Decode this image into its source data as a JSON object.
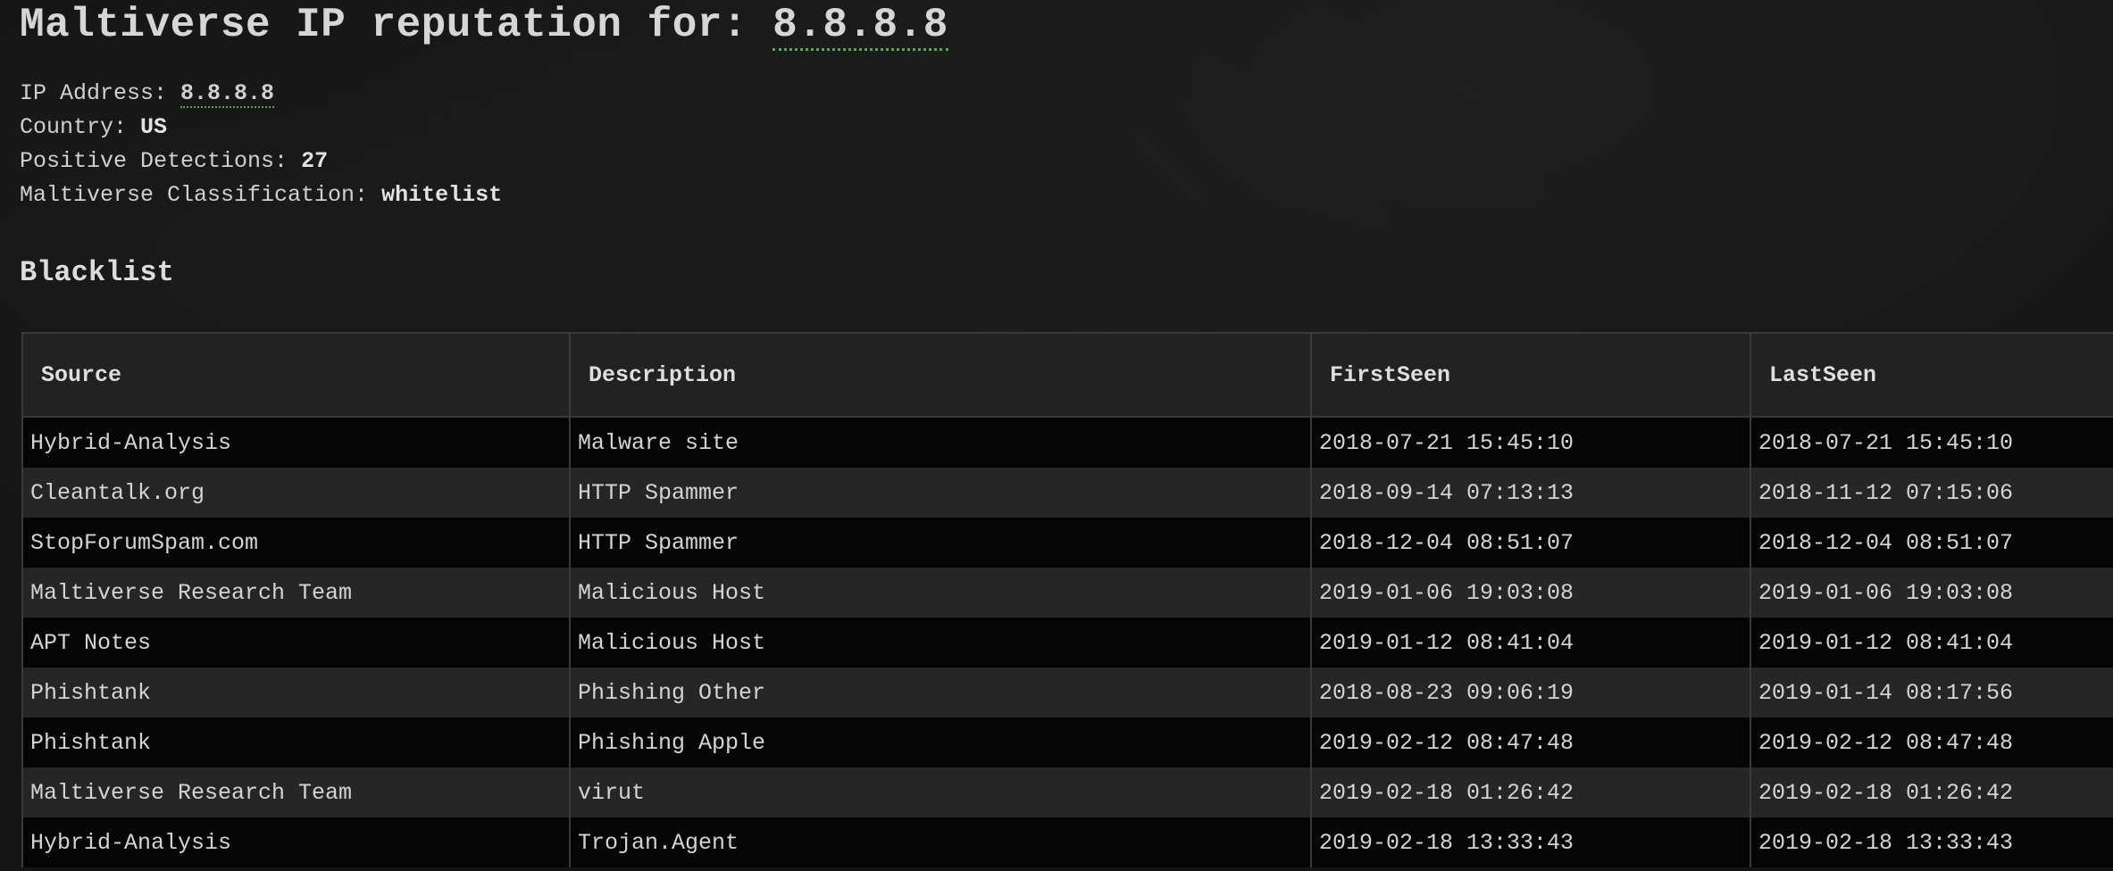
{
  "header": {
    "title_prefix": "Maltiverse IP reputation for: ",
    "title_ip": "8.8.8.8"
  },
  "info": {
    "ip_label": "IP Address: ",
    "ip_value": "8.8.8.8",
    "country_label": "Country: ",
    "country_value": "US",
    "detections_label": "Positive Detections: ",
    "detections_value": "27",
    "classification_label": "Maltiverse Classification: ",
    "classification_value": "whitelist"
  },
  "blacklist": {
    "heading": "Blacklist",
    "columns": [
      "Source",
      "Description",
      "FirstSeen",
      "LastSeen"
    ],
    "rows": [
      [
        "Hybrid-Analysis",
        "Malware site",
        "2018-07-21 15:45:10",
        "2018-07-21 15:45:10"
      ],
      [
        "Cleantalk.org",
        "HTTP Spammer",
        "2018-09-14 07:13:13",
        "2018-11-12 07:15:06"
      ],
      [
        "StopForumSpam.com",
        "HTTP Spammer",
        "2018-12-04 08:51:07",
        "2018-12-04 08:51:07"
      ],
      [
        "Maltiverse Research Team",
        "Malicious Host",
        "2019-01-06 19:03:08",
        "2019-01-06 19:03:08"
      ],
      [
        "APT Notes",
        "Malicious Host",
        "2019-01-12 08:41:04",
        "2019-01-12 08:41:04"
      ],
      [
        "Phishtank",
        "Phishing Other",
        "2018-08-23 09:06:19",
        "2019-01-14 08:17:56"
      ],
      [
        "Phishtank",
        "Phishing Apple",
        "2019-02-12 08:47:48",
        "2019-02-12 08:47:48"
      ],
      [
        "Maltiverse Research Team",
        "virut",
        "2019-02-18 01:26:42",
        "2019-02-18 01:26:42"
      ],
      [
        "Hybrid-Analysis",
        "Trojan.Agent",
        "2019-02-18 13:33:43",
        "2019-02-18 13:33:43"
      ]
    ]
  },
  "colors": {
    "background": "#141414",
    "header_row": "#222222",
    "row_dark": "#050505",
    "row_light": "#262626",
    "abbr_underline": "#4caf50"
  }
}
